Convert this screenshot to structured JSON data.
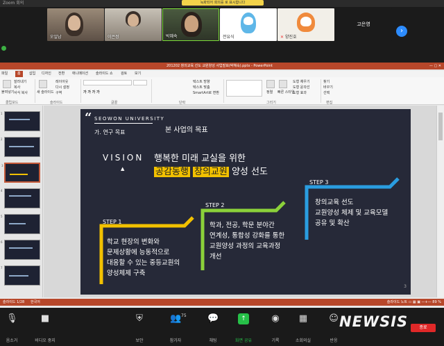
{
  "zoom": {
    "window_title": "Zoom 회의",
    "notice": "녹화되어 회의를 로 표시합니다",
    "participants": [
      {
        "name": "오일남",
        "muted": false
      },
      {
        "name": "이은정",
        "muted": false
      },
      {
        "name": "박혜숙",
        "muted": false
      },
      {
        "name": "전유식",
        "muted": false
      },
      {
        "name": "양진호",
        "muted": true
      },
      {
        "name": "고은영",
        "muted": false
      }
    ],
    "toolbar": {
      "mute": "음소거",
      "video": "비디오 중지",
      "security": "보안",
      "participants": "참가자",
      "participant_count": "75",
      "chat": "채팅",
      "share": "화면 공유",
      "record": "기록",
      "breakout": "소회의실",
      "reactions": "반응",
      "end": "종료"
    }
  },
  "powerpoint": {
    "title_doc": "201202 창의교육 선도 교원양성 사업발표(박혜숙).pptx - PowerPoint",
    "tabs": [
      "파일",
      "홈",
      "삽입",
      "디자인",
      "전환",
      "애니메이션",
      "슬라이드 쇼",
      "검토",
      "보기"
    ],
    "active_tab": "홈",
    "ribbon": {
      "paste": "붙여넣기",
      "cut": "잘라내기",
      "copy": "복사",
      "format_painter": "서식 복사",
      "new_slide": "새 슬라이드",
      "layout": "레이아웃",
      "reset": "다시 설정",
      "section": "구역",
      "text_direction": "텍스트 방향",
      "align_text": "텍스트 맞춤",
      "smartart": "SmartArt로 변환",
      "arrange": "정렬",
      "quick_styles": "빠른 스타일",
      "shape_fill": "도형 채우기",
      "shape_outline": "도형 윤곽선",
      "shape_effects": "도형 효과",
      "find": "찾기",
      "replace": "바꾸기",
      "select": "선택",
      "groups": [
        "클립보드",
        "슬라이드",
        "글꼴",
        "단락",
        "그리기",
        "편집"
      ]
    },
    "status": {
      "slide": "슬라이드 1/28",
      "language": "한국어",
      "notes": "슬라이드 노트",
      "zoom": "89 %"
    },
    "thumbnails": [
      1,
      2,
      3,
      4,
      5,
      6,
      7,
      8
    ],
    "selected_thumb": 3
  },
  "slide": {
    "university": "SEOWON UNIVERSITY",
    "section": "가. 연구 목표",
    "title": "본 사업의 목표",
    "vision": "VISION",
    "headline1": "행복한 미래 교실을 위한",
    "hl_a": "공감동행",
    "hl_b": "창의교원",
    "headline2_tail": "양성 선도",
    "steps": [
      {
        "label": "STEP 1",
        "lines": [
          "학교 현장의 변화와",
          "문제상황에 능동적으로",
          "대응할 수 있는 중등교원의",
          "양성체제 구축"
        ],
        "color": "#f2c100"
      },
      {
        "label": "STEP 2",
        "lines": [
          "학과, 전공, 학문 분야간",
          "연계성, 통합성 강화를 통한",
          "교원양성 과정의 교육과정",
          "개선"
        ],
        "color": "#8bd13a"
      },
      {
        "label": "STEP 3",
        "lines": [
          "창의교육 선도",
          "교원양성 체제 및 교육모델",
          "공유 및 확산"
        ],
        "color": "#2a9de0"
      }
    ],
    "page_number": "3"
  },
  "watermark": "NEWSIS"
}
